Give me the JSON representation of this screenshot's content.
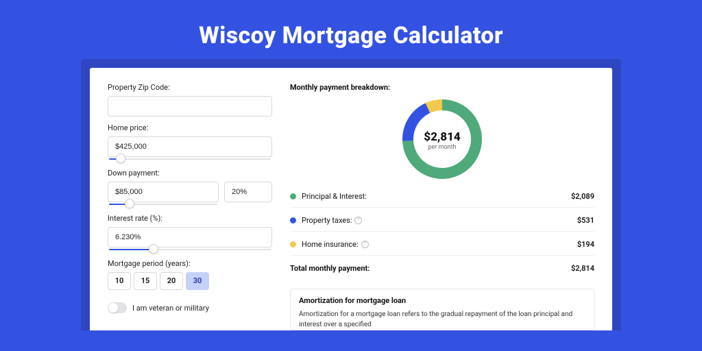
{
  "title": "Wiscoy Mortgage Calculator",
  "form": {
    "zip_label": "Property Zip Code:",
    "zip_value": "",
    "home_price_label": "Home price:",
    "home_price_value": "$425,000",
    "home_price_slider_pct": 8,
    "down_payment_label": "Down payment:",
    "down_payment_amount": "$85,000",
    "down_payment_percent": "20%",
    "down_payment_slider_pct": 20,
    "interest_label": "Interest rate (%):",
    "interest_value": "6.230%",
    "interest_slider_pct": 28,
    "period_label": "Mortgage period (years):",
    "period_options": [
      "10",
      "15",
      "20",
      "30"
    ],
    "period_selected_index": 3,
    "veteran_label": "I am veteran or military",
    "veteran_on": false
  },
  "breakdown": {
    "title": "Monthly payment breakdown:",
    "center_value": "$2,814",
    "center_sub": "per month",
    "items": [
      {
        "color": "green",
        "label": "Principal & Interest:",
        "value": "$2,089",
        "numeric": 2089,
        "info": false
      },
      {
        "color": "blue",
        "label": "Property taxes:",
        "value": "$531",
        "numeric": 531,
        "info": true
      },
      {
        "color": "yellow",
        "label": "Home insurance:",
        "value": "$194",
        "numeric": 194,
        "info": true
      }
    ],
    "total_label": "Total monthly payment:",
    "total_value": "$2,814"
  },
  "amortization": {
    "title": "Amortization for mortgage loan",
    "text": "Amortization for a mortgage loan refers to the gradual repayment of the loan principal and interest over a specified"
  },
  "chart_data": {
    "type": "pie",
    "title": "Monthly payment breakdown",
    "series": [
      {
        "name": "Principal & Interest",
        "value": 2089,
        "color": "#4fa97a"
      },
      {
        "name": "Property taxes",
        "value": 531,
        "color": "#3452e1"
      },
      {
        "name": "Home insurance",
        "value": 194,
        "color": "#f2c94c"
      }
    ],
    "total": 2814
  }
}
